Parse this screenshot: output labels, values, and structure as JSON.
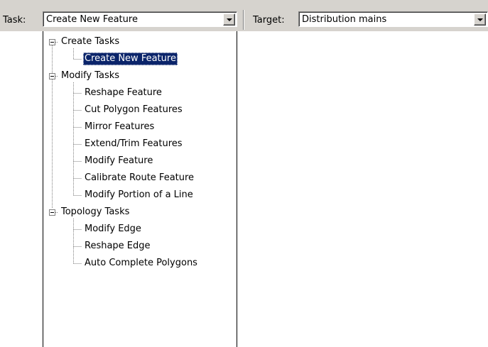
{
  "toolbar": {
    "task_label": "Task:",
    "task_value": "Create New Feature",
    "target_label": "Target:",
    "target_value": "Distribution mains"
  },
  "tree": {
    "groups": [
      {
        "label": "Create Tasks",
        "items": [
          "Create New Feature"
        ]
      },
      {
        "label": "Modify Tasks",
        "items": [
          "Reshape Feature",
          "Cut Polygon Features",
          "Mirror Features",
          "Extend/Trim Features",
          "Modify Feature",
          "Calibrate Route Feature",
          "Modify Portion of a Line"
        ]
      },
      {
        "label": "Topology Tasks",
        "items": [
          "Modify Edge",
          "Reshape Edge",
          "Auto Complete Polygons"
        ]
      }
    ],
    "selected": "Create New Feature"
  },
  "icons": {
    "expander": "minus-box-icon",
    "dropdown": "dropdown-arrow-icon"
  },
  "colors": {
    "selection": "#0a246a",
    "toolbar": "#d6d3ce"
  }
}
